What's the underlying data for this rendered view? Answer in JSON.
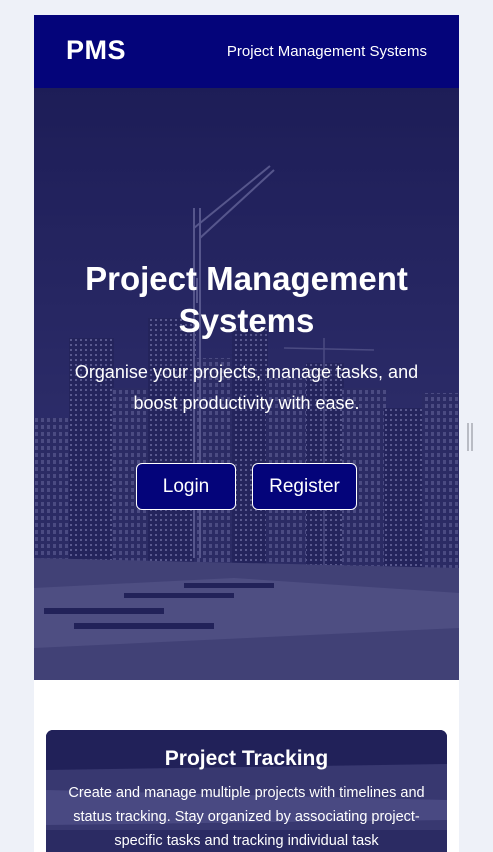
{
  "navbar": {
    "brand": "PMS",
    "link_label": "Project Management Systems",
    "background_color": "#04047a"
  },
  "hero": {
    "title": "Project Management Systems",
    "subtitle": "Organise your projects, manage tasks, and boost productivity with ease.",
    "buttons": {
      "login_label": "Login",
      "register_label": "Register"
    },
    "background_image": "city-construction-skyline-with-crane"
  },
  "features": [
    {
      "title": "Project Tracking",
      "description": "Create and manage multiple projects with timelines and status tracking. Stay organized by associating project-specific tasks and tracking individual task"
    }
  ],
  "colors": {
    "accent": "#04047a",
    "page_background": "#eef1f8"
  }
}
